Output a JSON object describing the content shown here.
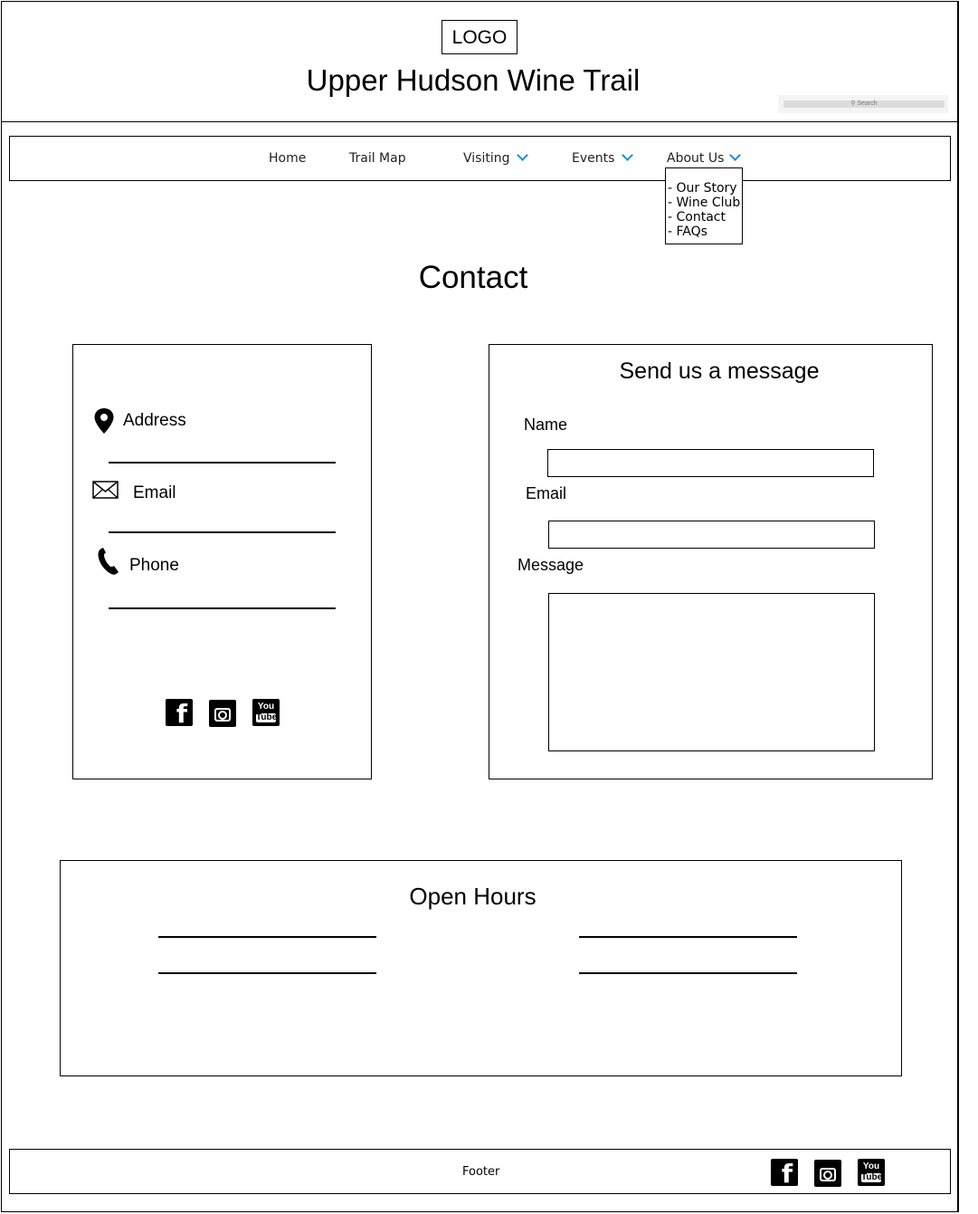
{
  "header": {
    "logo": "LOGO",
    "site_title": "Upper Hudson Wine Trail",
    "search_placeholder": "Search"
  },
  "nav": {
    "items": [
      {
        "label": "Home"
      },
      {
        "label": "Trail Map"
      },
      {
        "label": "Visiting"
      },
      {
        "label": "Events"
      },
      {
        "label": "About Us"
      }
    ],
    "about_dropdown": [
      "- Our Story",
      "- Wine Club",
      "- Contact",
      "- FAQs"
    ]
  },
  "page": {
    "title": "Contact"
  },
  "contact_info": {
    "address_label": "Address",
    "email_label": "Email",
    "phone_label": "Phone",
    "icons": [
      "map-pin-icon",
      "envelope-icon",
      "phone-icon",
      "facebook-icon",
      "instagram-icon",
      "youtube-icon"
    ]
  },
  "message_form": {
    "title": "Send us a message",
    "name_label": "Name",
    "email_label": "Email",
    "message_label": "Message"
  },
  "hours": {
    "title": "Open Hours"
  },
  "footer": {
    "label": "Footer",
    "social": {
      "facebook": "f",
      "youtube_top": "You",
      "youtube_bottom": "Tube"
    }
  }
}
